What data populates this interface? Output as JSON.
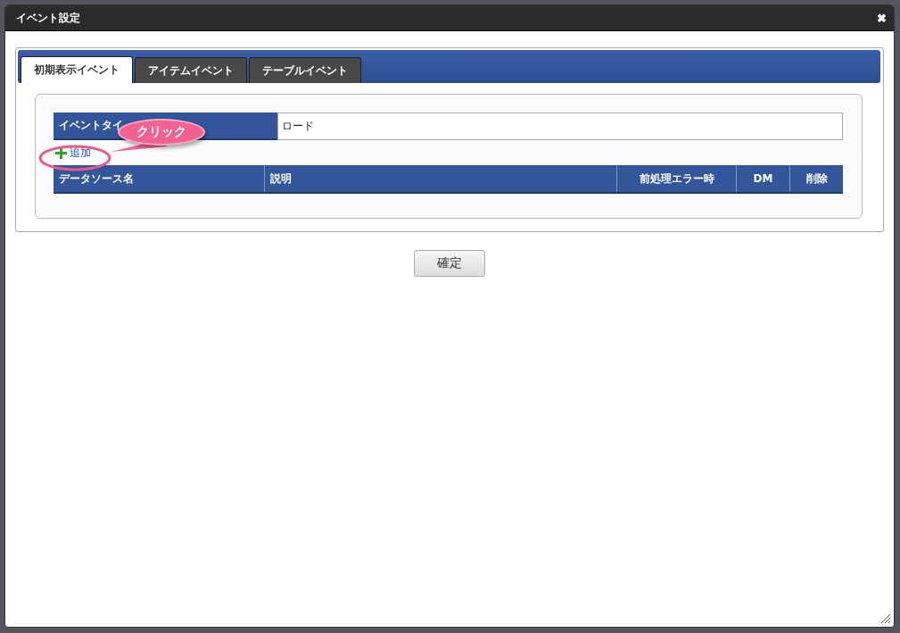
{
  "window": {
    "title": "イベント設定",
    "close": "✖"
  },
  "tabs": [
    {
      "label": "初期表示イベント",
      "selected": true
    },
    {
      "label": "アイテムイベント",
      "selected": false
    },
    {
      "label": "テーブルイベント",
      "selected": false
    }
  ],
  "event_type": {
    "label": "イベントタイ",
    "value": "ロード"
  },
  "add_link": "追加",
  "callout": "クリック",
  "table": {
    "columns": [
      {
        "label": "データソース名"
      },
      {
        "label": "説明"
      },
      {
        "label": "前処理エラー時"
      },
      {
        "label": "DM"
      },
      {
        "label": "削除"
      }
    ]
  },
  "buttons": [
    "確定"
  ]
}
